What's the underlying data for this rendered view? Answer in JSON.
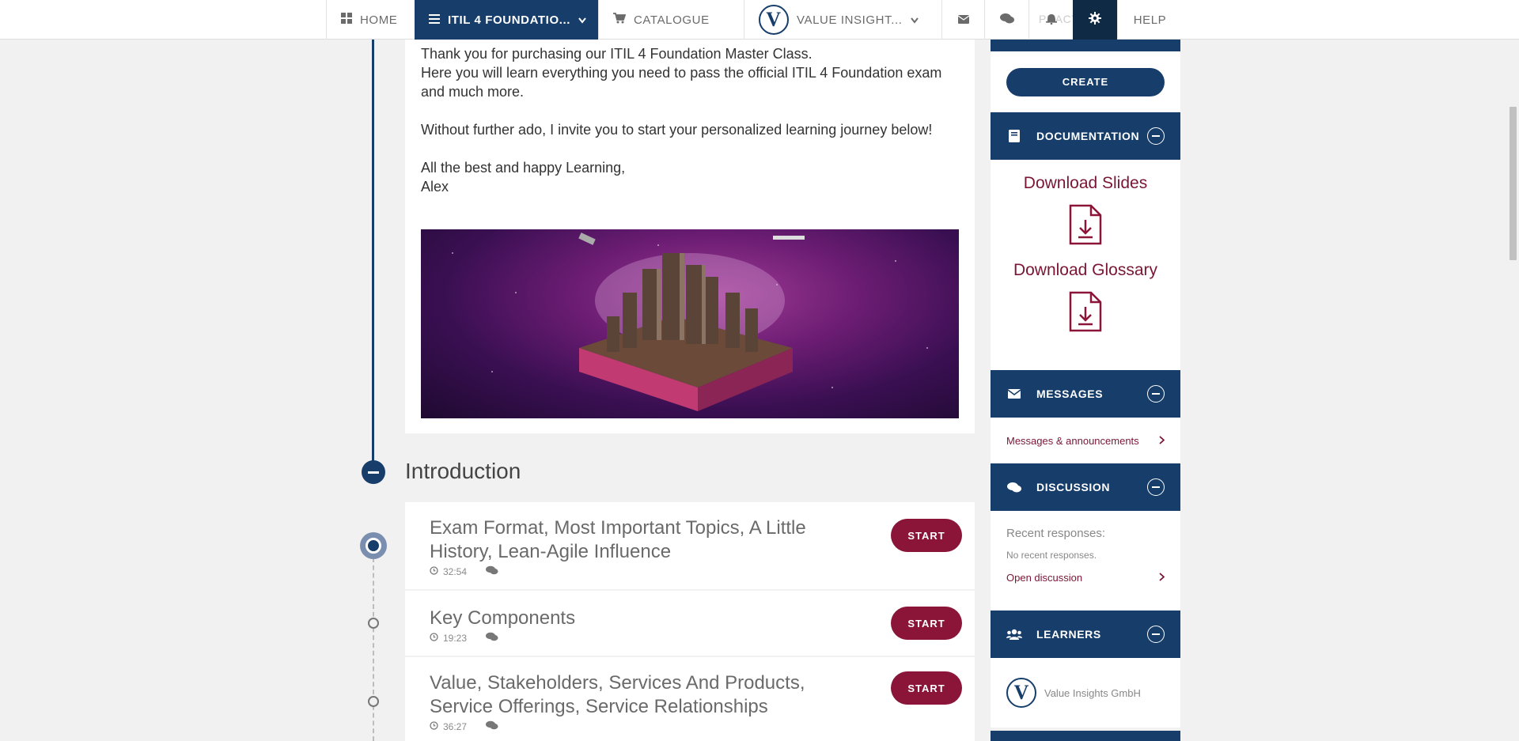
{
  "nav": {
    "home": "HOME",
    "course": "ITIL 4 FOUNDATIO...",
    "catalogue": "CATALOGUE",
    "org_logo_letter": "V",
    "org": "VALUE INSIGHT...",
    "help": "HELP",
    "hidden_tab": "PRACT"
  },
  "welcome": {
    "para1_line1": "Thank you for purchasing our ITIL 4 Foundation Master Class.",
    "para1_line2": "Here you will learn everything you need to pass the official ITIL 4 Foundation exam and much more.",
    "para2": "Without further ado, I invite you to start your personalized learning journey below!",
    "para3_line1": "All the best and happy Learning,",
    "para3_line2": "Alex"
  },
  "section": {
    "title": "Introduction"
  },
  "lessons": [
    {
      "title": "Exam Format, Most Important Topics, A Little History, Lean-Agile Influence",
      "duration": "32:54",
      "action": "START"
    },
    {
      "title": "Key Components",
      "duration": "19:23",
      "action": "START"
    },
    {
      "title": "Value, Stakeholders, Services And Products, Service Offerings, Service Relationships",
      "duration": "36:27",
      "action": "START"
    }
  ],
  "sidebar": {
    "create_label": "CREATE",
    "documentation": {
      "header": "DOCUMENTATION",
      "slides": "Download Slides",
      "glossary": "Download Glossary"
    },
    "messages": {
      "header": "MESSAGES",
      "link": "Messages & announcements"
    },
    "discussion": {
      "header": "DISCUSSION",
      "recent_label": "Recent responses:",
      "none": "No recent responses.",
      "open": "Open discussion"
    },
    "learners": {
      "header": "LEARNERS",
      "logo_letter": "V",
      "org_name": "Value Insights GmbH"
    }
  },
  "colors": {
    "navy": "#173e6b",
    "maroon": "#8a1538",
    "background": "#f1f1f1"
  }
}
